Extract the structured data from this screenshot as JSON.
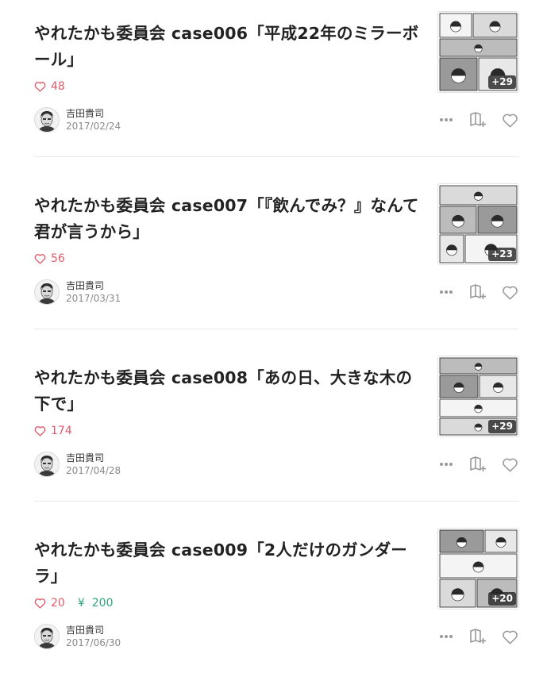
{
  "colors": {
    "like": "#e05a6a",
    "price": "#2ea37a",
    "title": "#222222",
    "date": "#8a8a8a",
    "icon": "#999999"
  },
  "icons": {
    "like_stat": "heart-outline-icon",
    "price": "yen-icon",
    "more": "more-horizontal-icon",
    "magazine": "add-to-magazine-icon",
    "like": "heart-outline-icon"
  },
  "articles": [
    {
      "title": "やれたかも委員会 case006「平成22年のミラーボール」",
      "likes": "48",
      "price_symbol": "",
      "price": "",
      "thumb_more": "+29",
      "author": "吉田貴司",
      "date": "2017/02/24"
    },
    {
      "title": "やれたかも委員会 case007「『飲んでみ？』なんて君が言うから」",
      "likes": "56",
      "price_symbol": "",
      "price": "",
      "thumb_more": "+23",
      "author": "吉田貴司",
      "date": "2017/03/31"
    },
    {
      "title": "やれたかも委員会 case008「あの日、大きな木の下で」",
      "likes": "174",
      "price_symbol": "",
      "price": "",
      "thumb_more": "+29",
      "author": "吉田貴司",
      "date": "2017/04/28"
    },
    {
      "title": "やれたかも委員会 case009「2人だけのガンダーラ」",
      "likes": "20",
      "price_symbol": "¥",
      "price": "200",
      "thumb_more": "+20",
      "author": "吉田貴司",
      "date": "2017/06/30"
    }
  ]
}
